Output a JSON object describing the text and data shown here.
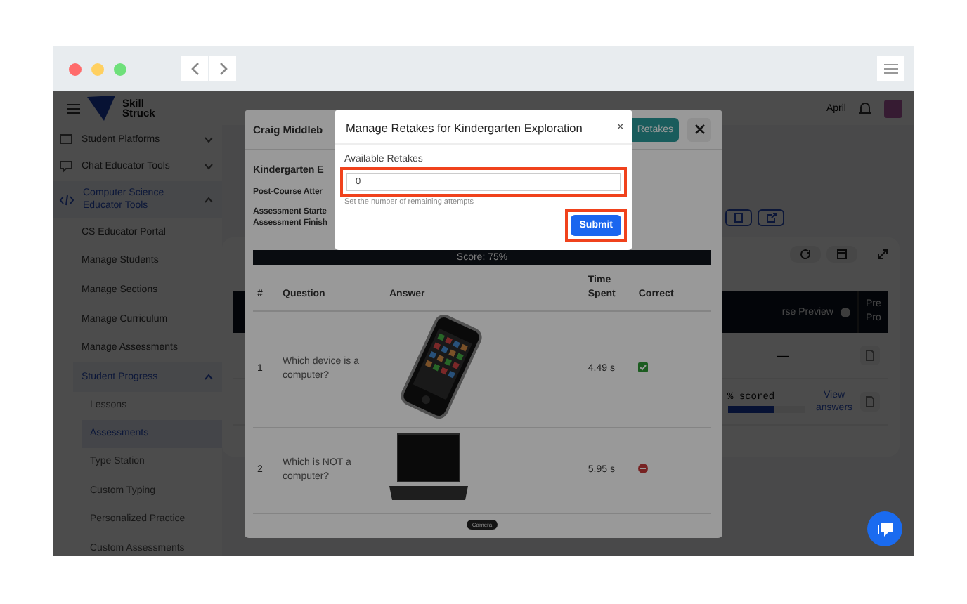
{
  "app_header": {
    "logo_lines": [
      "Skill",
      "Struck"
    ],
    "user_name": "April"
  },
  "sidebar": {
    "items": [
      {
        "label": "Student Platforms",
        "expanded": false,
        "selected": false
      },
      {
        "label": "Chat Educator Tools",
        "expanded": false,
        "selected": false
      },
      {
        "label": "Computer Science Educator Tools",
        "expanded": true,
        "selected": true,
        "children": [
          {
            "label": "CS Educator Portal",
            "selected": false
          },
          {
            "label": "Manage Students",
            "selected": false
          },
          {
            "label": "Manage Sections",
            "selected": false
          },
          {
            "label": "Manage Curriculum",
            "selected": false
          },
          {
            "label": "Manage Assessments",
            "selected": false
          },
          {
            "label": "Student Progress",
            "selected": true,
            "expanded": true,
            "children": [
              {
                "label": "Lessons",
                "selected": false
              },
              {
                "label": "Assessments",
                "selected": true
              },
              {
                "label": "Type Station",
                "selected": false
              },
              {
                "label": "Custom Typing",
                "selected": false
              },
              {
                "label": "Personalized Practice",
                "selected": false
              },
              {
                "label": "Custom Assessments",
                "selected": false
              }
            ]
          }
        ]
      }
    ]
  },
  "progress_table": {
    "columns": [
      "rse Preview",
      "Pre Pro"
    ],
    "rows": [
      {
        "preview": "—",
        "scored": null,
        "link": null
      },
      {
        "preview": null,
        "scored": "% scored",
        "level": 0.6,
        "link": "View answers"
      }
    ]
  },
  "assessment_modal": {
    "title": "Craig Middleb",
    "retakes_button": "Retakes",
    "section_title": "Kindergarten E",
    "details": [
      "Post-Course Atter",
      "Assessment Starte",
      "Assessment Finish"
    ],
    "score": "Score: 75%",
    "columns": [
      "#",
      "Question",
      "Answer",
      "Time Spent",
      "Correct"
    ],
    "rows": [
      {
        "number": "1",
        "question": "Which device is a computer?",
        "kind": "phone",
        "time": "4.49 s",
        "correct": true
      },
      {
        "number": "2",
        "question": "Which is NOT a computer?",
        "kind": "laptop",
        "time": "5.95 s",
        "correct": false
      }
    ],
    "footer_label": "Camera"
  },
  "retakes_modal": {
    "title": "Manage Retakes for Kindergarten Exploration",
    "close": "×",
    "field_label": "Available Retakes",
    "value": "0",
    "helper": "Set the number of remaining attempts",
    "submit": "Submit",
    "field_highlighted": true,
    "submit_highlighted": true
  }
}
